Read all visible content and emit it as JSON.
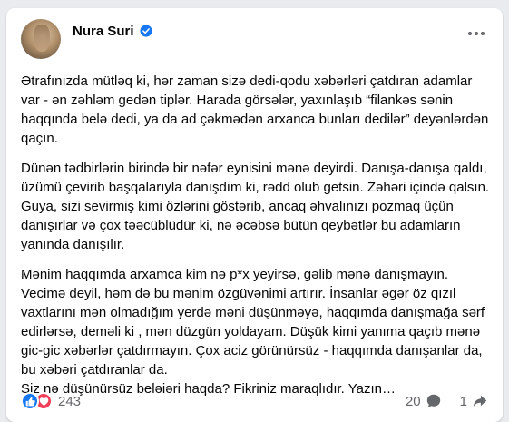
{
  "post": {
    "author": "Nura Suri",
    "paragraphs": [
      "Ətrafınızda mütləq ki, hər zaman sizə dedi-qodu xəbərləri çatdıran adamlar var - ən zəhləm gedən tiplər. Harada görsələr, yaxınlaşıb “filankəs sənin haqqında belə dedi, ya da ad çəkmədən arxanca bunları dedilər” deyənlərdən qaçın.",
      "Dünən tədbirlərin birində bir nəfər eynisini mənə deyirdi. Danışa-danışa qaldı, üzümü çevirib başqalarıyla danışdım ki, rədd olub getsin. Zəhəri içində qalsın. Guya, sizi sevirmiş kimi özlərini göstərib, ancaq əhvalınızı pozmaq üçün danışırlar və çox təəcüblüdür ki, nə əcəbsə bütün qeybətlər bu adamların yanında danışılır.",
      "Mənim haqqımda arxamca kim nə p*x yeyirsə, gəlib mənə danışmayın. Vecimə deyil, həm də bu mənim özgüvənimi artırır. İnsanlar əgər öz qızıl vaxtlarını mən olmadığım yerdə məni düşünməyə, haqqımda danışmağa sərf edirlərsə, deməli ki , mən düzgün yoldayam. Düşük kimi yanıma qaçıb mənə gic-gic xəbərlər çatdırmayın. Çox aciz görünürsüz -  haqqımda danışanlar da, bu xəbəri çatdıranlar da.\nSiz nə düşünürsüz beləiəri haqda? Fikriniz maraqlıdır. Yazın…"
    ],
    "reaction_count": "243",
    "comment_count": "20",
    "share_count": "1"
  },
  "icons": {
    "verified": "verified-badge-icon",
    "more": "more-options-icon",
    "like": "like-icon",
    "love": "love-icon",
    "comment": "comment-icon",
    "share": "share-icon"
  },
  "colors": {
    "accent": "#1877f2",
    "love": "#f33e58",
    "secondary_text": "#65676b"
  }
}
